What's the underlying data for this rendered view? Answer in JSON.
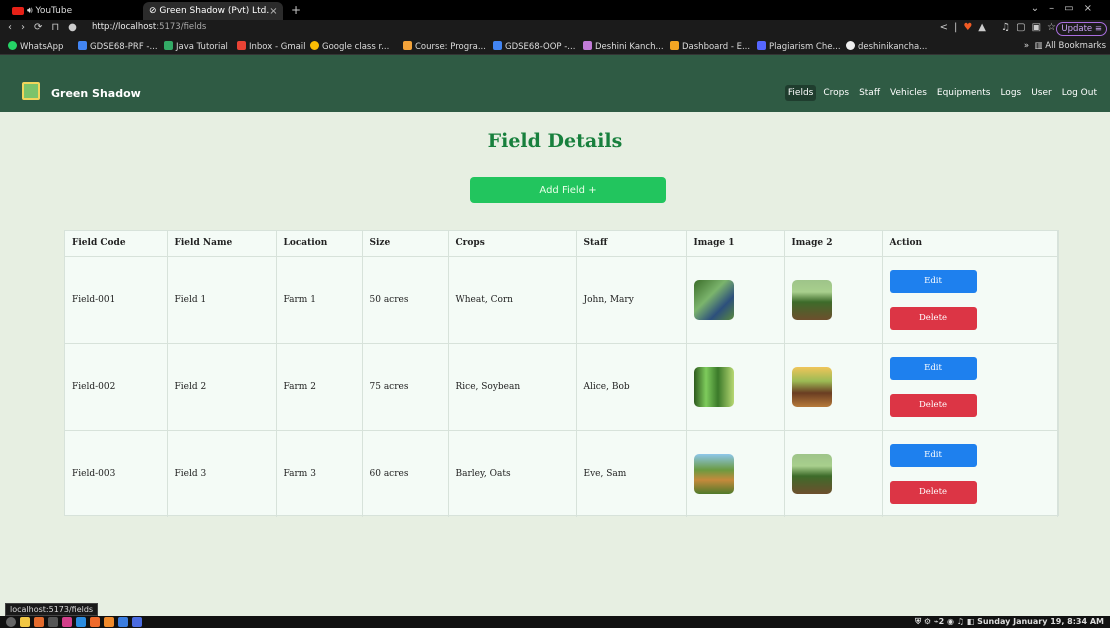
{
  "browser": {
    "tabs": [
      {
        "label": "YouTube"
      },
      {
        "label": "Green Shadow (Pvt) Ltd."
      }
    ],
    "url_host": "http://localhost",
    "url_path": ":5173/fields",
    "update_label": "Update",
    "bookmarks": [
      "WhatsApp",
      "GDSE68-PRF -...",
      "Java Tutorial",
      "Inbox - Gmail",
      "Google class r...",
      "Course: Progra...",
      "GDSE68-OOP -...",
      "Deshini Kanch...",
      "Dashboard - E...",
      "Plagiarism Che...",
      "deshinikancha..."
    ],
    "all_bookmarks": "All Bookmarks"
  },
  "navbar": {
    "brand": "Green Shadow",
    "links": [
      "Fields",
      "Crops",
      "Staff",
      "Vehicles",
      "Equipments",
      "Logs",
      "User",
      "Log Out"
    ]
  },
  "page": {
    "title": "Field Details",
    "add_button": "Add Field +"
  },
  "table": {
    "headers": [
      "Field Code",
      "Field Name",
      "Location",
      "Size",
      "Crops",
      "Staff",
      "Image 1",
      "Image 2",
      "Action"
    ],
    "rows": [
      {
        "code": "Field-001",
        "name": "Field 1",
        "location": "Farm 1",
        "size": "50 acres",
        "crops": "Wheat, Corn",
        "staff": "John, Mary"
      },
      {
        "code": "Field-002",
        "name": "Field 2",
        "location": "Farm 2",
        "size": "75 acres",
        "crops": "Rice, Soybean",
        "staff": "Alice, Bob"
      },
      {
        "code": "Field-003",
        "name": "Field 3",
        "location": "Farm 3",
        "size": "60 acres",
        "crops": "Barley, Oats",
        "staff": "Eve, Sam"
      }
    ],
    "edit_label": "Edit",
    "delete_label": "Delete"
  },
  "status_url": "localhost:5173/fields",
  "clock": "Sunday January 19, 8:34 AM"
}
